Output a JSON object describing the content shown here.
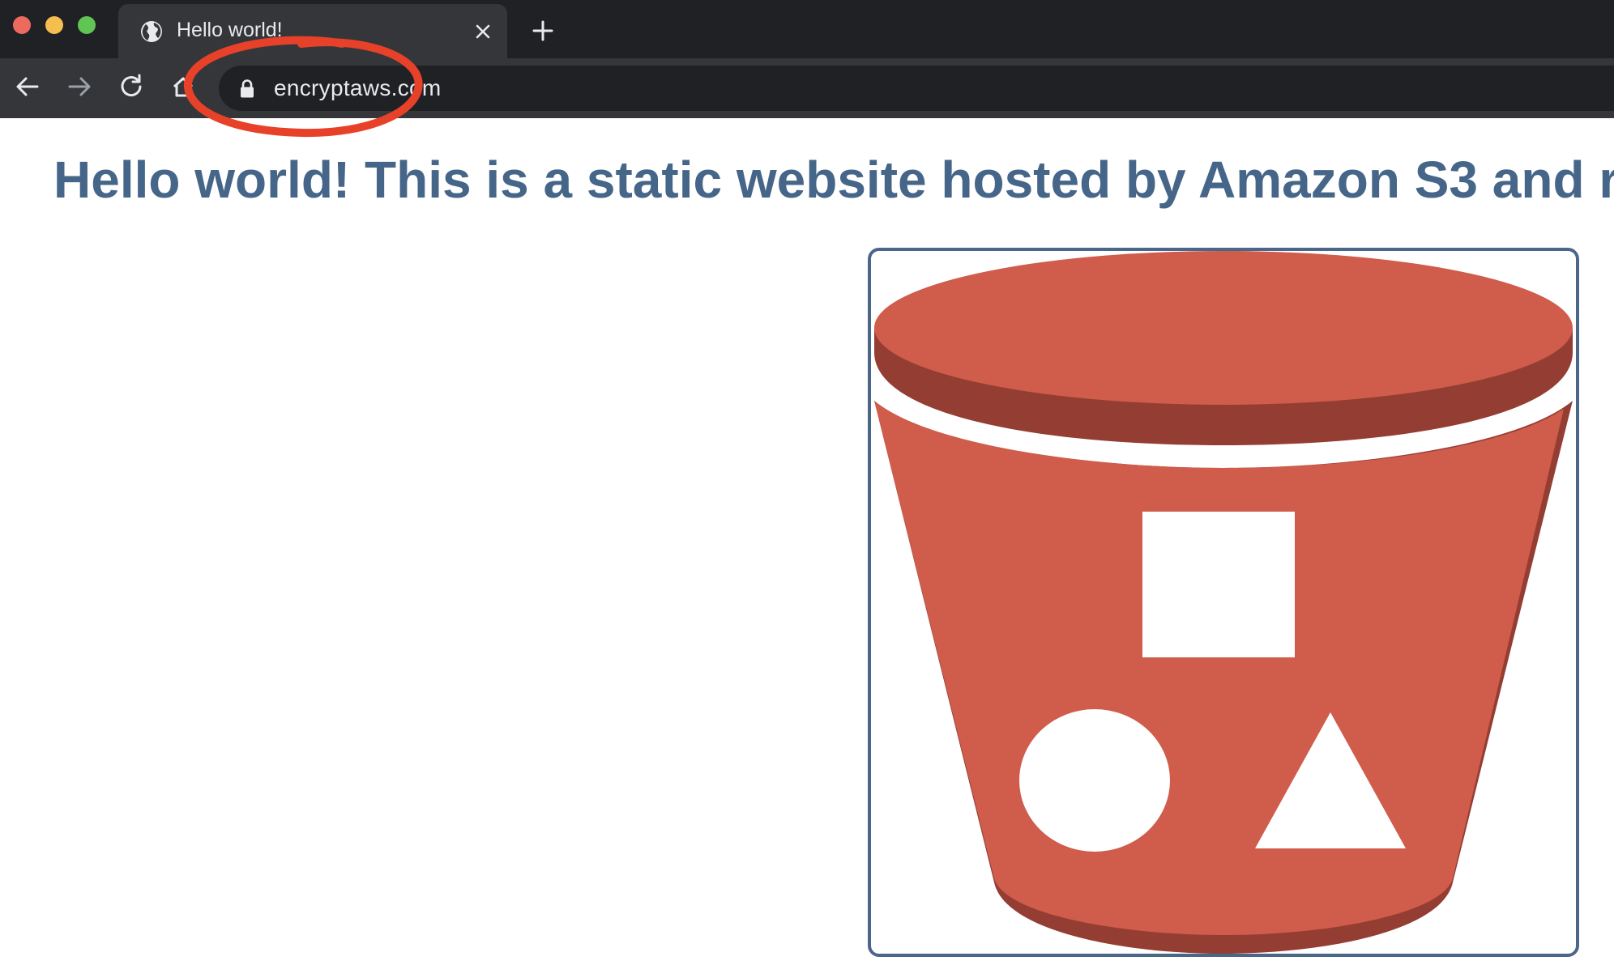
{
  "browser": {
    "window_controls": [
      "close",
      "minimize",
      "maximize"
    ],
    "tab": {
      "title": "Hello world!",
      "favicon": "globe-icon",
      "close_icon": "close-icon"
    },
    "new_tab_icon": "plus-icon",
    "nav": {
      "back_icon": "arrow-left-icon",
      "forward_icon": "arrow-right-icon",
      "reload_icon": "reload-icon",
      "home_icon": "home-icon"
    },
    "address_bar": {
      "secure_icon": "lock-icon",
      "url": "encryptaws.com"
    }
  },
  "annotation": {
    "type": "hand-drawn ellipse around domain",
    "color": "#e8412a"
  },
  "page": {
    "heading": "Hello world! This is a static website hosted by Amazon S3 and r",
    "heading_color": "#466689",
    "image": {
      "icon": "amazon-s3-bucket-icon",
      "colors": {
        "bucket": "#d05c4b",
        "bucket_shadow": "#943d33",
        "frame": "#4a6688"
      }
    }
  },
  "colors": {
    "titlebar": "#202124",
    "toolbar": "#35363a",
    "omnibox": "#202124",
    "text_light": "#e8eaed"
  }
}
